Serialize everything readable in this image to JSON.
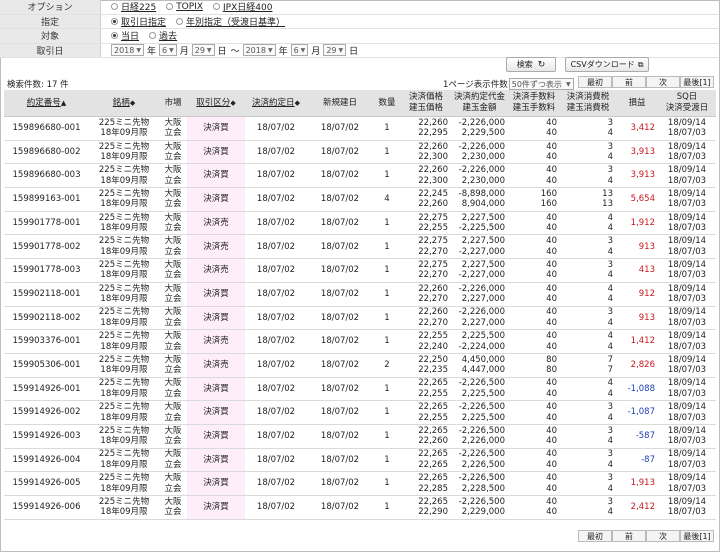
{
  "form": {
    "option": {
      "label": "オプション",
      "choices": [
        "日経225",
        "TOPIX",
        "JPX日経400"
      ]
    },
    "designation": {
      "label": "指定",
      "choices": [
        "取引日指定",
        "年別指定（受渡日基準）"
      ],
      "selected": 0
    },
    "target": {
      "label": "対象",
      "choices": [
        "当日",
        "過去"
      ],
      "selected": 0
    },
    "trade_date": {
      "label": "取引日",
      "from": {
        "year": "2018",
        "month": "6",
        "day": "29"
      },
      "to": {
        "year": "2018",
        "month": "6",
        "day": "29"
      },
      "units": {
        "year": "年",
        "month": "月",
        "day": "日"
      },
      "range_sep": "～"
    }
  },
  "search_button": "検索",
  "csv_button": "CSVダウンロード",
  "result_count": "検索件数: 17 件",
  "per_page": {
    "label": "1ページ表示件数",
    "value": "50件ずつ表示"
  },
  "pager": {
    "first": "最初",
    "prev": "前",
    "next": "次",
    "last": "最後[1]"
  },
  "columns": {
    "contract_no": "約定番号",
    "symbol": "銘柄",
    "market": "市場",
    "trade_type": "取引区分",
    "settle_date": "決済約定日",
    "new_date": "新規建日",
    "qty": "数量",
    "price_a": "決済価格",
    "price_b": "建玉価格",
    "amount_a": "決済約定代金",
    "amount_b": "建玉金額",
    "fee_a": "決済手数料",
    "fee_b": "建玉手数料",
    "tax_a": "決済消費税",
    "tax_b": "建玉消費税",
    "pl": "損益",
    "sq_a": "SQ日",
    "sq_b": "決済受渡日"
  },
  "sort_marker": "▲",
  "sort_both": "◆",
  "rows": [
    {
      "no": "159896680-001",
      "sym1": "225ミニ先物",
      "sym2": "18年09月限",
      "mkt1": "大阪",
      "mkt2": "立会",
      "type": "決済買",
      "sdate": "18/07/02",
      "ndate": "18/07/02",
      "qty": "1",
      "p1": "22,260",
      "p2": "22,295",
      "a1": "-2,226,000",
      "a2": "2,229,500",
      "f1": "40",
      "f2": "40",
      "t1": "3",
      "t2": "4",
      "pl": "3,412",
      "d1": "18/09/14",
      "d2": "18/07/03"
    },
    {
      "no": "159896680-002",
      "sym1": "225ミニ先物",
      "sym2": "18年09月限",
      "mkt1": "大阪",
      "mkt2": "立会",
      "type": "決済買",
      "sdate": "18/07/02",
      "ndate": "18/07/02",
      "qty": "1",
      "p1": "22,260",
      "p2": "22,300",
      "a1": "-2,226,000",
      "a2": "2,230,000",
      "f1": "40",
      "f2": "40",
      "t1": "3",
      "t2": "4",
      "pl": "3,913",
      "d1": "18/09/14",
      "d2": "18/07/03"
    },
    {
      "no": "159896680-003",
      "sym1": "225ミニ先物",
      "sym2": "18年09月限",
      "mkt1": "大阪",
      "mkt2": "立会",
      "type": "決済買",
      "sdate": "18/07/02",
      "ndate": "18/07/02",
      "qty": "1",
      "p1": "22,260",
      "p2": "22,300",
      "a1": "-2,226,000",
      "a2": "2,230,000",
      "f1": "40",
      "f2": "40",
      "t1": "3",
      "t2": "4",
      "pl": "3,913",
      "d1": "18/09/14",
      "d2": "18/07/03"
    },
    {
      "no": "159899163-001",
      "sym1": "225ミニ先物",
      "sym2": "18年09月限",
      "mkt1": "大阪",
      "mkt2": "立会",
      "type": "決済買",
      "sdate": "18/07/02",
      "ndate": "18/07/02",
      "qty": "4",
      "p1": "22,245",
      "p2": "22,260",
      "a1": "-8,898,000",
      "a2": "8,904,000",
      "f1": "160",
      "f2": "160",
      "t1": "13",
      "t2": "13",
      "pl": "5,654",
      "d1": "18/09/14",
      "d2": "18/07/03"
    },
    {
      "no": "159901778-001",
      "sym1": "225ミニ先物",
      "sym2": "18年09月限",
      "mkt1": "大阪",
      "mkt2": "立会",
      "type": "決済売",
      "sdate": "18/07/02",
      "ndate": "18/07/02",
      "qty": "1",
      "p1": "22,275",
      "p2": "22,255",
      "a1": "2,227,500",
      "a2": "-2,225,500",
      "f1": "40",
      "f2": "40",
      "t1": "4",
      "t2": "4",
      "pl": "1,912",
      "d1": "18/09/14",
      "d2": "18/07/03"
    },
    {
      "no": "159901778-002",
      "sym1": "225ミニ先物",
      "sym2": "18年09月限",
      "mkt1": "大阪",
      "mkt2": "立会",
      "type": "決済売",
      "sdate": "18/07/02",
      "ndate": "18/07/02",
      "qty": "1",
      "p1": "22,275",
      "p2": "22,270",
      "a1": "2,227,500",
      "a2": "-2,227,000",
      "f1": "40",
      "f2": "40",
      "t1": "3",
      "t2": "4",
      "pl": "913",
      "d1": "18/09/14",
      "d2": "18/07/03"
    },
    {
      "no": "159901778-003",
      "sym1": "225ミニ先物",
      "sym2": "18年09月限",
      "mkt1": "大阪",
      "mkt2": "立会",
      "type": "決済売",
      "sdate": "18/07/02",
      "ndate": "18/07/02",
      "qty": "1",
      "p1": "22,275",
      "p2": "22,270",
      "a1": "2,227,500",
      "a2": "-2,227,000",
      "f1": "40",
      "f2": "40",
      "t1": "3",
      "t2": "4",
      "pl": "413",
      "d1": "18/09/14",
      "d2": "18/07/03"
    },
    {
      "no": "159902118-001",
      "sym1": "225ミニ先物",
      "sym2": "18年09月限",
      "mkt1": "大阪",
      "mkt2": "立会",
      "type": "決済買",
      "sdate": "18/07/02",
      "ndate": "18/07/02",
      "qty": "1",
      "p1": "22,260",
      "p2": "22,270",
      "a1": "-2,226,000",
      "a2": "2,227,000",
      "f1": "40",
      "f2": "40",
      "t1": "4",
      "t2": "4",
      "pl": "912",
      "d1": "18/09/14",
      "d2": "18/07/03"
    },
    {
      "no": "159902118-002",
      "sym1": "225ミニ先物",
      "sym2": "18年09月限",
      "mkt1": "大阪",
      "mkt2": "立会",
      "type": "決済買",
      "sdate": "18/07/02",
      "ndate": "18/07/02",
      "qty": "1",
      "p1": "22,260",
      "p2": "22,270",
      "a1": "-2,226,000",
      "a2": "2,227,000",
      "f1": "40",
      "f2": "40",
      "t1": "3",
      "t2": "4",
      "pl": "913",
      "d1": "18/09/14",
      "d2": "18/07/03"
    },
    {
      "no": "159903376-001",
      "sym1": "225ミニ先物",
      "sym2": "18年09月限",
      "mkt1": "大阪",
      "mkt2": "立会",
      "type": "決済売",
      "sdate": "18/07/02",
      "ndate": "18/07/02",
      "qty": "1",
      "p1": "22,255",
      "p2": "22,240",
      "a1": "2,225,500",
      "a2": "-2,224,000",
      "f1": "40",
      "f2": "40",
      "t1": "4",
      "t2": "4",
      "pl": "1,412",
      "d1": "18/09/14",
      "d2": "18/07/03"
    },
    {
      "no": "159905306-001",
      "sym1": "225ミニ先物",
      "sym2": "18年09月限",
      "mkt1": "大阪",
      "mkt2": "立会",
      "type": "決済売",
      "sdate": "18/07/02",
      "ndate": "18/07/02",
      "qty": "2",
      "p1": "22,250",
      "p2": "22,235",
      "a1": "4,450,000",
      "a2": "4,447,000",
      "f1": "80",
      "f2": "80",
      "t1": "7",
      "t2": "7",
      "pl": "2,826",
      "d1": "18/09/14",
      "d2": "18/07/03"
    },
    {
      "no": "159914926-001",
      "sym1": "225ミニ先物",
      "sym2": "18年09月限",
      "mkt1": "大阪",
      "mkt2": "立会",
      "type": "決済買",
      "sdate": "18/07/02",
      "ndate": "18/07/02",
      "qty": "1",
      "p1": "22,265",
      "p2": "22,255",
      "a1": "-2,226,500",
      "a2": "2,225,500",
      "f1": "40",
      "f2": "40",
      "t1": "4",
      "t2": "4",
      "pl": "-1,088",
      "d1": "18/09/14",
      "d2": "18/07/03"
    },
    {
      "no": "159914926-002",
      "sym1": "225ミニ先物",
      "sym2": "18年09月限",
      "mkt1": "大阪",
      "mkt2": "立会",
      "type": "決済買",
      "sdate": "18/07/02",
      "ndate": "18/07/02",
      "qty": "1",
      "p1": "22,265",
      "p2": "22,255",
      "a1": "-2,226,500",
      "a2": "2,225,500",
      "f1": "40",
      "f2": "40",
      "t1": "3",
      "t2": "4",
      "pl": "-1,087",
      "d1": "18/09/14",
      "d2": "18/07/03"
    },
    {
      "no": "159914926-003",
      "sym1": "225ミニ先物",
      "sym2": "18年09月限",
      "mkt1": "大阪",
      "mkt2": "立会",
      "type": "決済買",
      "sdate": "18/07/02",
      "ndate": "18/07/02",
      "qty": "1",
      "p1": "22,265",
      "p2": "22,260",
      "a1": "-2,226,500",
      "a2": "2,226,000",
      "f1": "40",
      "f2": "40",
      "t1": "3",
      "t2": "4",
      "pl": "-587",
      "d1": "18/09/14",
      "d2": "18/07/03"
    },
    {
      "no": "159914926-004",
      "sym1": "225ミニ先物",
      "sym2": "18年09月限",
      "mkt1": "大阪",
      "mkt2": "立会",
      "type": "決済買",
      "sdate": "18/07/02",
      "ndate": "18/07/02",
      "qty": "1",
      "p1": "22,265",
      "p2": "22,265",
      "a1": "-2,226,500",
      "a2": "2,226,500",
      "f1": "40",
      "f2": "40",
      "t1": "3",
      "t2": "4",
      "pl": "-87",
      "d1": "18/09/14",
      "d2": "18/07/03"
    },
    {
      "no": "159914926-005",
      "sym1": "225ミニ先物",
      "sym2": "18年09月限",
      "mkt1": "大阪",
      "mkt2": "立会",
      "type": "決済買",
      "sdate": "18/07/02",
      "ndate": "18/07/02",
      "qty": "1",
      "p1": "22,265",
      "p2": "22,285",
      "a1": "-2,226,500",
      "a2": "2,228,500",
      "f1": "40",
      "f2": "40",
      "t1": "3",
      "t2": "4",
      "pl": "1,913",
      "d1": "18/09/14",
      "d2": "18/07/03"
    },
    {
      "no": "159914926-006",
      "sym1": "225ミニ先物",
      "sym2": "18年09月限",
      "mkt1": "大阪",
      "mkt2": "立会",
      "type": "決済買",
      "sdate": "18/07/02",
      "ndate": "18/07/02",
      "qty": "1",
      "p1": "22,265",
      "p2": "22,290",
      "a1": "-2,226,500",
      "a2": "2,229,000",
      "f1": "40",
      "f2": "40",
      "t1": "3",
      "t2": "4",
      "pl": "2,412",
      "d1": "18/09/14",
      "d2": "18/07/03"
    }
  ]
}
